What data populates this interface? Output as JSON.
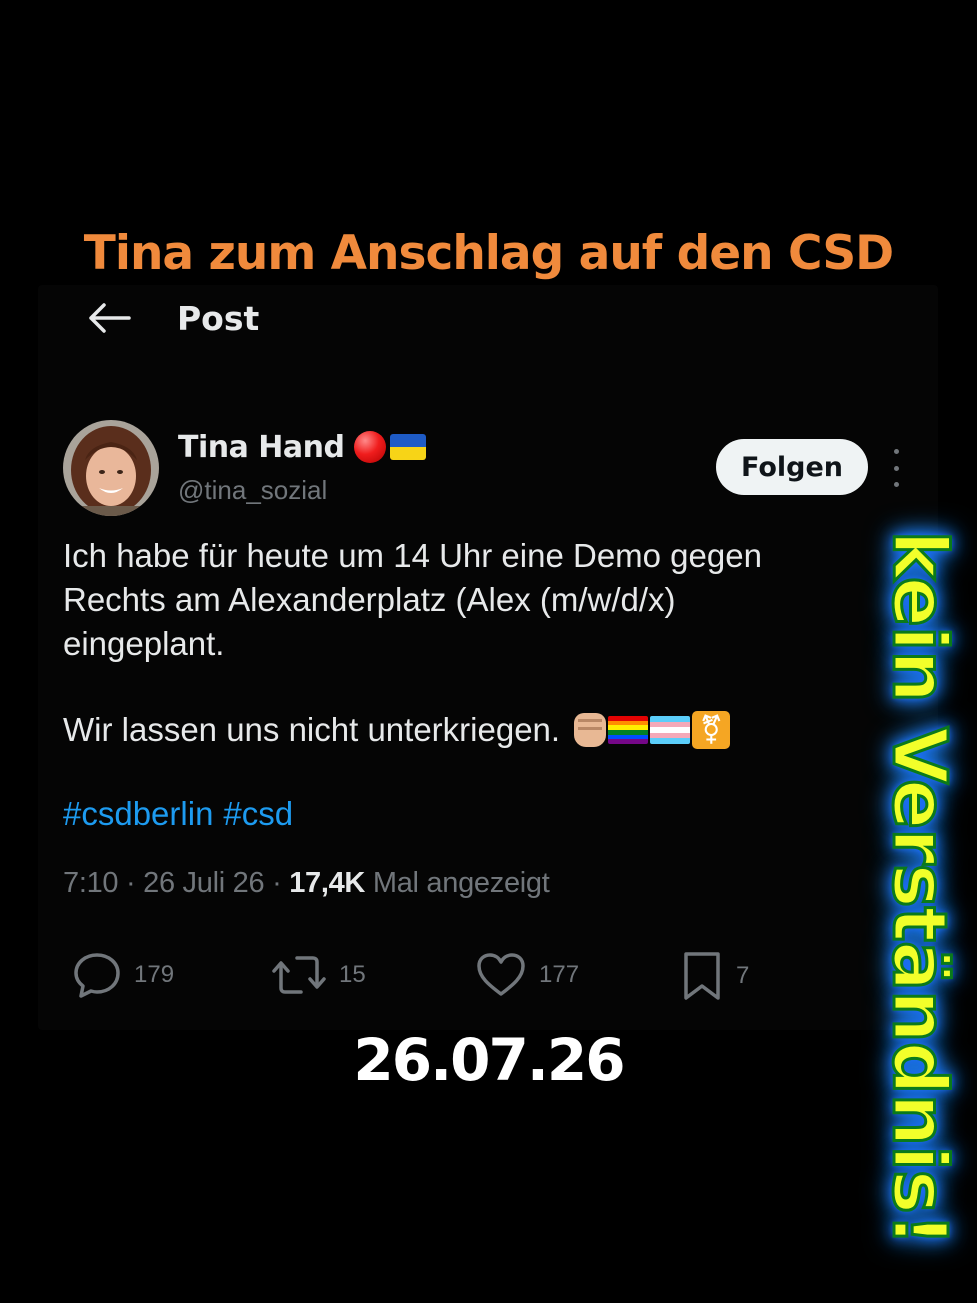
{
  "overlay": {
    "title": "Tina zum Anschlag auf den CSD",
    "date_stamp": "26.07.26",
    "side_banner": "kein Verständnis!"
  },
  "header": {
    "title": "Post"
  },
  "author": {
    "name": "Tina Hand",
    "handle": "@tina_sozial",
    "follow_label": "Folgen"
  },
  "post": {
    "text_lines": [
      "Ich habe für heute um 14 Uhr eine Demo gegen",
      "Rechts am Alexanderplatz (Alex (m/w/d/x)",
      "eingeplant."
    ],
    "text_line2": "Wir lassen uns nicht unterkriegen.",
    "hashtags": [
      "#csdberlin",
      "#csd"
    ],
    "time": "7:10",
    "date": "26 Juli 26",
    "views": "17,4K",
    "views_label": "Mal angezeigt"
  },
  "actions": {
    "replies": "179",
    "reposts": "15",
    "likes": "177",
    "bookmarks": "7"
  },
  "colors": {
    "accent": "#1d9bf0",
    "overlay_title": "#f08a3c",
    "muted": "#71767b",
    "banner_text": "#f2ff2a",
    "banner_glow": "#1e90ff"
  },
  "icons": {
    "back": "arrow-left-icon",
    "more": "more-vertical-icon",
    "reply": "comment-icon",
    "repost": "repost-icon",
    "like": "heart-icon",
    "bookmark": "bookmark-icon"
  }
}
